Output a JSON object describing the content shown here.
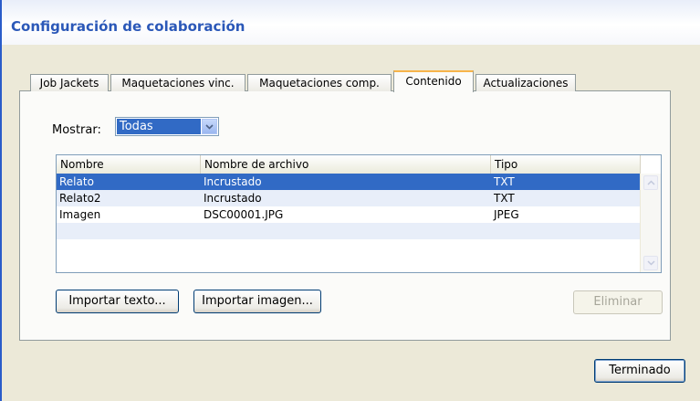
{
  "window": {
    "title": "Configuración de colaboración"
  },
  "tabs": [
    {
      "label": "Job Jackets",
      "active": false
    },
    {
      "label": "Maquetaciones vinc.",
      "active": false
    },
    {
      "label": "Maquetaciones comp.",
      "active": false
    },
    {
      "label": "Contenido",
      "active": true
    },
    {
      "label": "Actualizaciones",
      "active": false
    }
  ],
  "filter": {
    "label": "Mostrar:",
    "selected": "Todas"
  },
  "table": {
    "columns": [
      "Nombre",
      "Nombre de archivo",
      "Tipo"
    ],
    "rows": [
      {
        "name": "Relato",
        "file": "Incrustado",
        "type": "TXT",
        "selected": true
      },
      {
        "name": "Relato2",
        "file": "Incrustado",
        "type": "TXT",
        "selected": false
      },
      {
        "name": "Imagen",
        "file": "DSC00001.JPG",
        "type": "JPEG",
        "selected": false
      }
    ]
  },
  "buttons": {
    "import_text": "Importar texto...",
    "import_image": "Importar imagen...",
    "delete": "Eliminar",
    "done": "Terminado"
  },
  "icons": {
    "dropdown": "chevron-down-icon",
    "scroll_up": "scroll-up-arrow-icon",
    "scroll_down": "scroll-down-arrow-icon"
  },
  "colors": {
    "selection": "#316ac5",
    "title": "#2b58b8",
    "active_tab_accent": "#f7b44a",
    "dialog_bg": "#ece9d8"
  }
}
